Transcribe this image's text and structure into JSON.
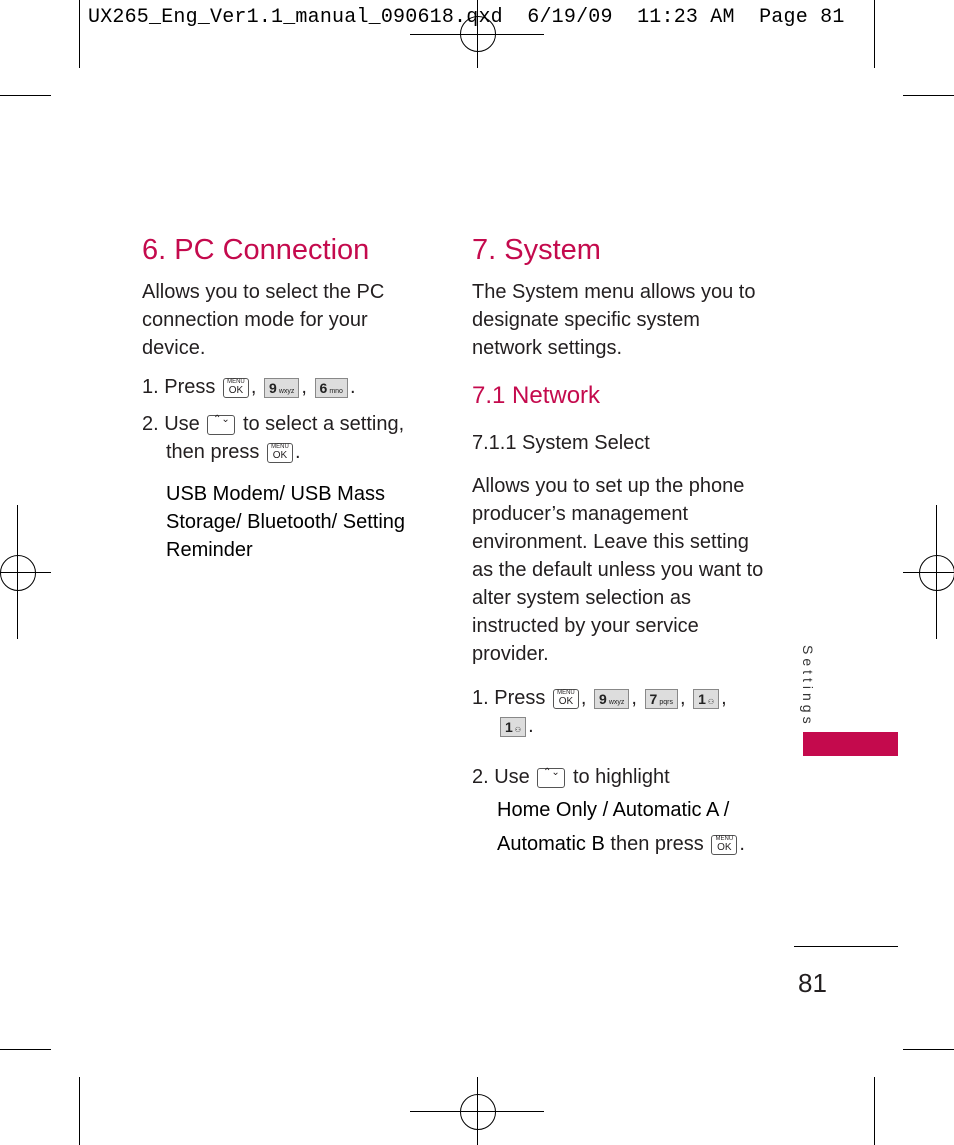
{
  "slug": "UX265_Eng_Ver1.1_manual_090618.qxd  6/19/09  11:23 AM  Page 81",
  "left": {
    "title": "6. PC Connection",
    "intro": "Allows you to select the PC connection mode for your device.",
    "step1_prefix": "1. Press",
    "step2_prefix": "2. Use",
    "step2_suffix": "to select a setting,",
    "step2_line2": "then press",
    "options": "USB Modem/ USB Mass Storage/ Bluetooth/ Setting Reminder"
  },
  "right": {
    "title": "7. System",
    "intro": "The System menu allows you to designate specific system network settings.",
    "subtitle": "7.1 Network",
    "subsubtitle": "7.1.1 System Select",
    "body": "Allows you to set up the phone producer’s management environment. Leave this setting as the default unless you want to alter system selection as instructed by your service provider.",
    "step1_prefix": "1. Press",
    "step2_prefix": "2. Use",
    "step2_suffix": "to highlight",
    "options_line1": "Home Only / Automatic A /",
    "options_line2_bold": "Automatic B",
    "options_line2_rest": "then press"
  },
  "keys": {
    "menu_top": "MENU",
    "menu_ok": "OK",
    "k9": "9",
    "k9_sub": "wxyz",
    "k6": "6",
    "k6_sub": "mno",
    "k7": "7",
    "k7_sub": "pqrs",
    "k1": "1",
    "k1_sub": "⚇",
    "nav": "⌃⌄"
  },
  "sidebar": {
    "label": "Settings",
    "accent": "#c40a4d"
  },
  "page_number": "81"
}
